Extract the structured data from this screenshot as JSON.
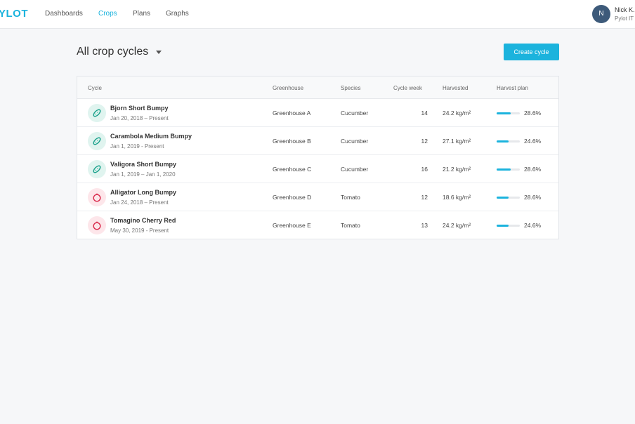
{
  "app": {
    "logo": "YLOT"
  },
  "nav": {
    "items": [
      {
        "label": "Dashboards",
        "active": false
      },
      {
        "label": "Crops",
        "active": true
      },
      {
        "label": "Plans",
        "active": false
      },
      {
        "label": "Graphs",
        "active": false
      }
    ]
  },
  "user": {
    "initial": "N",
    "name": "Nick K.",
    "org": "Pylot IT"
  },
  "page": {
    "title": "All crop cycles",
    "create_label": "Create cycle"
  },
  "table": {
    "headers": {
      "cycle": "Cycle",
      "greenhouse": "Greenhouse",
      "species": "Species",
      "week": "Cycle week",
      "harvested": "Harvested",
      "plan": "Harvest plan"
    },
    "rows": [
      {
        "icon": "cucumber-icon",
        "name": "Bjorn Short Bumpy",
        "dates": "Jan 20, 2018 – Present",
        "greenhouse": "Greenhouse A",
        "species": "Cucumber",
        "week": "14",
        "harvested": "24.2 kg/m²",
        "plan_pct": "28.6%",
        "plan_fraction": 0.6
      },
      {
        "icon": "cucumber-icon",
        "name": "Carambola Medium Bumpy",
        "dates": "Jan 1, 2019 - Present",
        "greenhouse": "Greenhouse B",
        "species": "Cucumber",
        "week": "12",
        "harvested": "27.1 kg/m²",
        "plan_pct": "24.6%",
        "plan_fraction": 0.5
      },
      {
        "icon": "cucumber-icon",
        "name": "Valigora Short Bumpy",
        "dates": "Jan 1, 2019 – Jan 1, 2020",
        "greenhouse": "Greenhouse C",
        "species": "Cucumber",
        "week": "16",
        "harvested": "21.2 kg/m²",
        "plan_pct": "28.6%",
        "plan_fraction": 0.6
      },
      {
        "icon": "tomato-icon",
        "name": "Alligator Long Bumpy",
        "dates": "Jan 24, 2018 – Present",
        "greenhouse": "Greenhouse D",
        "species": "Tomato",
        "week": "12",
        "harvested": "18.6 kg/m²",
        "plan_pct": "28.6%",
        "plan_fraction": 0.5
      },
      {
        "icon": "tomato-icon",
        "name": "Tomagino Cherry Red",
        "dates": "May 30, 2019 - Present",
        "greenhouse": "Greenhouse E",
        "species": "Tomato",
        "week": "13",
        "harvested": "24.2 kg/m²",
        "plan_pct": "24.6%",
        "plan_fraction": 0.5
      }
    ]
  },
  "colors": {
    "accent": "#1bb3dd",
    "cucumber": "#17a08a",
    "tomato": "#d9284a"
  }
}
